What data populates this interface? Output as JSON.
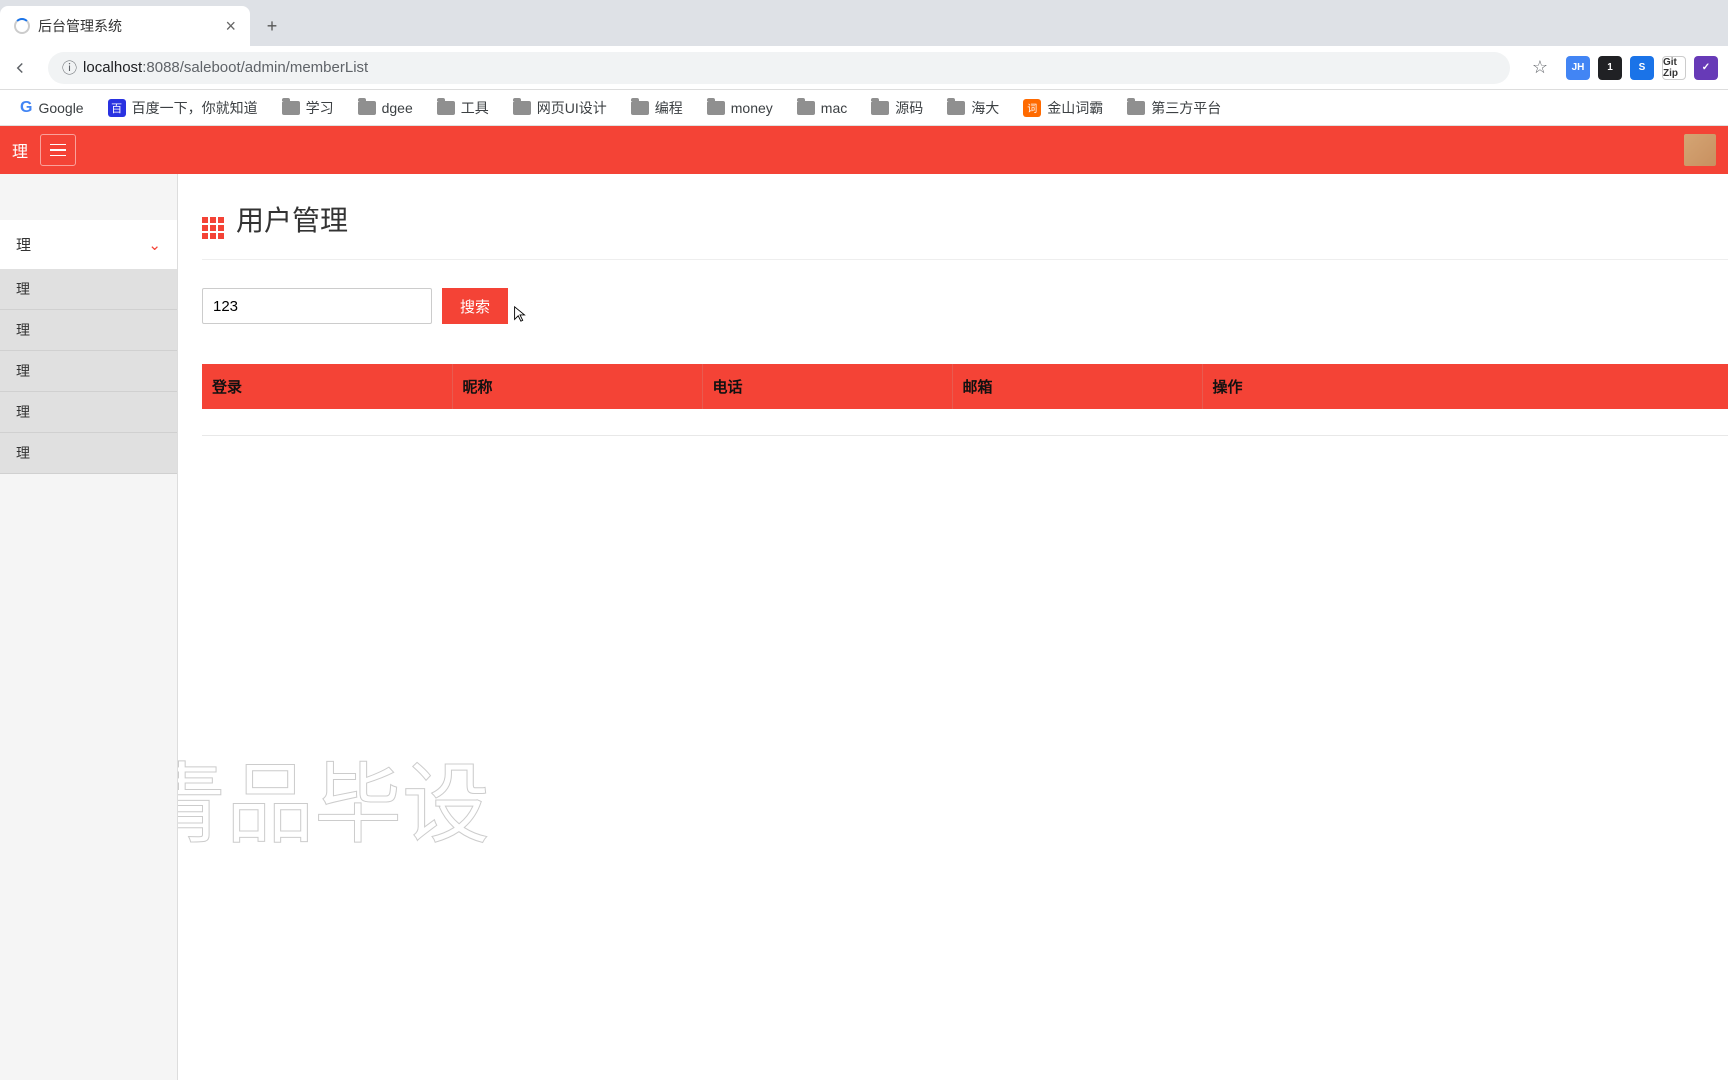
{
  "browser": {
    "tab_title": "后台管理系统",
    "url_host": "localhost",
    "url_port": ":8088",
    "url_path": "/saleboot/admin/memberList",
    "extensions": [
      {
        "label": "JH",
        "bg": "#4285f4"
      },
      {
        "label": "1",
        "bg": "#202124"
      },
      {
        "label": "S",
        "bg": "#1a73e8"
      },
      {
        "label": "Git Zip",
        "bg": "#fff"
      },
      {
        "label": "✓",
        "bg": "#673ab7"
      }
    ]
  },
  "bookmarks": [
    {
      "icon": "google",
      "label": "Google"
    },
    {
      "icon": "baidu",
      "label": "百度一下，你就知道"
    },
    {
      "icon": "folder",
      "label": "学习"
    },
    {
      "icon": "folder",
      "label": "dgee"
    },
    {
      "icon": "folder",
      "label": "工具"
    },
    {
      "icon": "folder",
      "label": "网页UI设计"
    },
    {
      "icon": "folder",
      "label": "编程"
    },
    {
      "icon": "folder",
      "label": "money"
    },
    {
      "icon": "folder",
      "label": "mac"
    },
    {
      "icon": "folder",
      "label": "源码"
    },
    {
      "icon": "folder",
      "label": "海大"
    },
    {
      "icon": "jinshan",
      "label": "金山词霸"
    },
    {
      "icon": "folder",
      "label": "第三方平台"
    }
  ],
  "header": {
    "brand": "理"
  },
  "sidebar": {
    "section": "理",
    "items": [
      "理",
      "理",
      "理",
      "理",
      "理"
    ]
  },
  "page": {
    "title": "用户管理",
    "search_value": "123",
    "search_btn": "搜索"
  },
  "table": {
    "columns": [
      "登录",
      "昵称",
      "电话",
      "邮箱",
      "操作"
    ],
    "col_widths": [
      "250px",
      "250px",
      "250px",
      "250px",
      "auto"
    ]
  },
  "watermark": "青品毕设"
}
